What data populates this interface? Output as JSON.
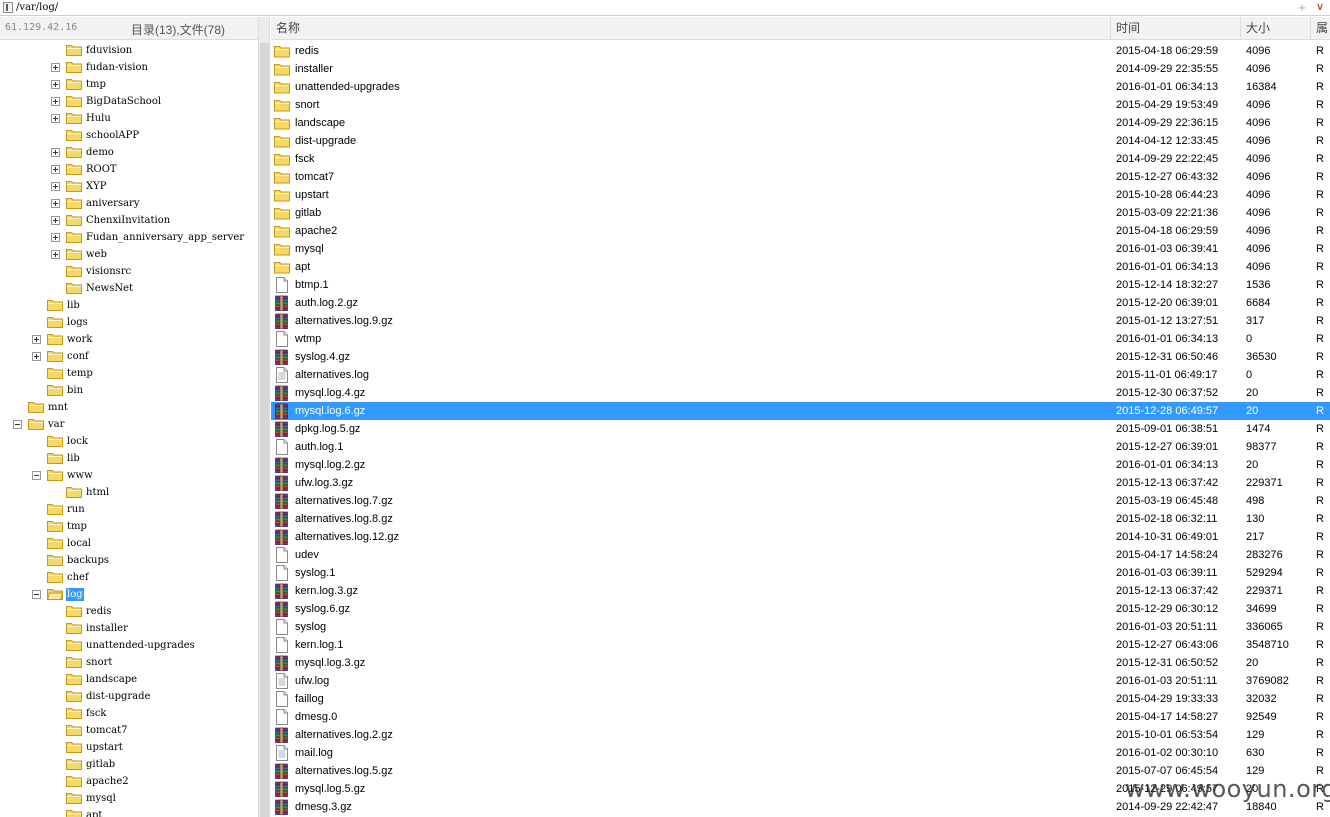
{
  "address_bar": {
    "path": "/var/log/"
  },
  "left_panel": {
    "host": "61.129.42.16",
    "summary": "目录(13),文件(78)",
    "tree": [
      {
        "label": "fduvision",
        "level": 3,
        "toggle": "none"
      },
      {
        "label": "fudan-vision",
        "level": 3,
        "toggle": "plus"
      },
      {
        "label": "tmp",
        "level": 3,
        "toggle": "plus"
      },
      {
        "label": "BigDataSchool",
        "level": 3,
        "toggle": "plus"
      },
      {
        "label": "Hulu",
        "level": 3,
        "toggle": "plus"
      },
      {
        "label": "schoolAPP",
        "level": 3,
        "toggle": "none"
      },
      {
        "label": "demo",
        "level": 3,
        "toggle": "plus"
      },
      {
        "label": "ROOT",
        "level": 3,
        "toggle": "plus"
      },
      {
        "label": "XYP",
        "level": 3,
        "toggle": "plus"
      },
      {
        "label": "aniversary",
        "level": 3,
        "toggle": "plus"
      },
      {
        "label": "ChenxiInvitation",
        "level": 3,
        "toggle": "plus"
      },
      {
        "label": "Fudan_anniversary_app_server",
        "level": 3,
        "toggle": "plus"
      },
      {
        "label": "web",
        "level": 3,
        "toggle": "plus"
      },
      {
        "label": "visionsrc",
        "level": 3,
        "toggle": "none"
      },
      {
        "label": "NewsNet",
        "level": 3,
        "toggle": "none"
      },
      {
        "label": "lib",
        "level": 2,
        "toggle": "none"
      },
      {
        "label": "logs",
        "level": 2,
        "toggle": "none"
      },
      {
        "label": "work",
        "level": 2,
        "toggle": "plus"
      },
      {
        "label": "conf",
        "level": 2,
        "toggle": "plus"
      },
      {
        "label": "temp",
        "level": 2,
        "toggle": "none"
      },
      {
        "label": "bin",
        "level": 2,
        "toggle": "none"
      },
      {
        "label": "mnt",
        "level": 1,
        "toggle": "none"
      },
      {
        "label": "var",
        "level": 1,
        "toggle": "minus"
      },
      {
        "label": "lock",
        "level": 2,
        "toggle": "none"
      },
      {
        "label": "lib",
        "level": 2,
        "toggle": "none"
      },
      {
        "label": "www",
        "level": 2,
        "toggle": "minus"
      },
      {
        "label": "html",
        "level": 3,
        "toggle": "none"
      },
      {
        "label": "run",
        "level": 2,
        "toggle": "none"
      },
      {
        "label": "tmp",
        "level": 2,
        "toggle": "none"
      },
      {
        "label": "local",
        "level": 2,
        "toggle": "none"
      },
      {
        "label": "backups",
        "level": 2,
        "toggle": "none"
      },
      {
        "label": "chef",
        "level": 2,
        "toggle": "none"
      },
      {
        "label": "log",
        "level": 2,
        "toggle": "minus",
        "selected": true,
        "open": true
      },
      {
        "label": "redis",
        "level": 3,
        "toggle": "none"
      },
      {
        "label": "installer",
        "level": 3,
        "toggle": "none"
      },
      {
        "label": "unattended-upgrades",
        "level": 3,
        "toggle": "none"
      },
      {
        "label": "snort",
        "level": 3,
        "toggle": "none"
      },
      {
        "label": "landscape",
        "level": 3,
        "toggle": "none"
      },
      {
        "label": "dist-upgrade",
        "level": 3,
        "toggle": "none"
      },
      {
        "label": "fsck",
        "level": 3,
        "toggle": "none"
      },
      {
        "label": "tomcat7",
        "level": 3,
        "toggle": "none"
      },
      {
        "label": "upstart",
        "level": 3,
        "toggle": "none"
      },
      {
        "label": "gitlab",
        "level": 3,
        "toggle": "none"
      },
      {
        "label": "apache2",
        "level": 3,
        "toggle": "none"
      },
      {
        "label": "mysql",
        "level": 3,
        "toggle": "none"
      },
      {
        "label": "apt",
        "level": 3,
        "toggle": "none"
      }
    ]
  },
  "file_list": {
    "columns": {
      "name": "名称",
      "time": "时间",
      "size": "大小",
      "perm": "属"
    },
    "files": [
      {
        "name": "redis",
        "time": "2015-04-18 06:29:59",
        "size": "4096",
        "perm": "R",
        "type": "folder"
      },
      {
        "name": "installer",
        "time": "2014-09-29 22:35:55",
        "size": "4096",
        "perm": "R",
        "type": "folder"
      },
      {
        "name": "unattended-upgrades",
        "time": "2016-01-01 06:34:13",
        "size": "16384",
        "perm": "R",
        "type": "folder"
      },
      {
        "name": "snort",
        "time": "2015-04-29 19:53:49",
        "size": "4096",
        "perm": "R",
        "type": "folder"
      },
      {
        "name": "landscape",
        "time": "2014-09-29 22:36:15",
        "size": "4096",
        "perm": "R",
        "type": "folder"
      },
      {
        "name": "dist-upgrade",
        "time": "2014-04-12 12:33:45",
        "size": "4096",
        "perm": "R",
        "type": "folder"
      },
      {
        "name": "fsck",
        "time": "2014-09-29 22:22:45",
        "size": "4096",
        "perm": "R",
        "type": "folder"
      },
      {
        "name": "tomcat7",
        "time": "2015-12-27 06:43:32",
        "size": "4096",
        "perm": "R",
        "type": "folder"
      },
      {
        "name": "upstart",
        "time": "2015-10-28 06:44:23",
        "size": "4096",
        "perm": "R",
        "type": "folder"
      },
      {
        "name": "gitlab",
        "time": "2015-03-09 22:21:36",
        "size": "4096",
        "perm": "R",
        "type": "folder"
      },
      {
        "name": "apache2",
        "time": "2015-04-18 06:29:59",
        "size": "4096",
        "perm": "R",
        "type": "folder"
      },
      {
        "name": "mysql",
        "time": "2016-01-03 06:39:41",
        "size": "4096",
        "perm": "R",
        "type": "folder"
      },
      {
        "name": "apt",
        "time": "2016-01-01 06:34:13",
        "size": "4096",
        "perm": "R",
        "type": "folder"
      },
      {
        "name": "btmp.1",
        "time": "2015-12-14 18:32:27",
        "size": "1536",
        "perm": "R",
        "type": "file"
      },
      {
        "name": "auth.log.2.gz",
        "time": "2015-12-20 06:39:01",
        "size": "6684",
        "perm": "R",
        "type": "archive"
      },
      {
        "name": "alternatives.log.9.gz",
        "time": "2015-01-12 13:27:51",
        "size": "317",
        "perm": "R",
        "type": "archive"
      },
      {
        "name": "wtmp",
        "time": "2016-01-01 06:34:13",
        "size": "0",
        "perm": "R",
        "type": "file"
      },
      {
        "name": "syslog.4.gz",
        "time": "2015-12-31 06:50:46",
        "size": "36530",
        "perm": "R",
        "type": "archive"
      },
      {
        "name": "alternatives.log",
        "time": "2015-11-01 06:49:17",
        "size": "0",
        "perm": "R",
        "type": "text"
      },
      {
        "name": "mysql.log.4.gz",
        "time": "2015-12-30 06:37:52",
        "size": "20",
        "perm": "R",
        "type": "archive"
      },
      {
        "name": "mysql.log.6.gz",
        "time": "2015-12-28 06:49:57",
        "size": "20",
        "perm": "R",
        "type": "archive",
        "selected": true
      },
      {
        "name": "dpkg.log.5.gz",
        "time": "2015-09-01 06:38:51",
        "size": "1474",
        "perm": "R",
        "type": "archive"
      },
      {
        "name": "auth.log.1",
        "time": "2015-12-27 06:39:01",
        "size": "98377",
        "perm": "R",
        "type": "file"
      },
      {
        "name": "mysql.log.2.gz",
        "time": "2016-01-01 06:34:13",
        "size": "20",
        "perm": "R",
        "type": "archive"
      },
      {
        "name": "ufw.log.3.gz",
        "time": "2015-12-13 06:37:42",
        "size": "229371",
        "perm": "R",
        "type": "archive"
      },
      {
        "name": "alternatives.log.7.gz",
        "time": "2015-03-19 06:45:48",
        "size": "498",
        "perm": "R",
        "type": "archive"
      },
      {
        "name": "alternatives.log.8.gz",
        "time": "2015-02-18 06:32:11",
        "size": "130",
        "perm": "R",
        "type": "archive"
      },
      {
        "name": "alternatives.log.12.gz",
        "time": "2014-10-31 06:49:01",
        "size": "217",
        "perm": "R",
        "type": "archive"
      },
      {
        "name": "udev",
        "time": "2015-04-17 14:58:24",
        "size": "283276",
        "perm": "R",
        "type": "file"
      },
      {
        "name": "syslog.1",
        "time": "2016-01-03 06:39:11",
        "size": "529294",
        "perm": "R",
        "type": "file"
      },
      {
        "name": "kern.log.3.gz",
        "time": "2015-12-13 06:37:42",
        "size": "229371",
        "perm": "R",
        "type": "archive"
      },
      {
        "name": "syslog.6.gz",
        "time": "2015-12-29 06:30:12",
        "size": "34699",
        "perm": "R",
        "type": "archive"
      },
      {
        "name": "syslog",
        "time": "2016-01-03 20:51:11",
        "size": "336065",
        "perm": "R",
        "type": "file"
      },
      {
        "name": "kern.log.1",
        "time": "2015-12-27 06:43:06",
        "size": "3548710",
        "perm": "R",
        "type": "file"
      },
      {
        "name": "mysql.log.3.gz",
        "time": "2015-12-31 06:50:52",
        "size": "20",
        "perm": "R",
        "type": "archive"
      },
      {
        "name": "ufw.log",
        "time": "2016-01-03 20:51:11",
        "size": "3769082",
        "perm": "R",
        "type": "text"
      },
      {
        "name": "faillog",
        "time": "2015-04-29 19:33:33",
        "size": "32032",
        "perm": "R",
        "type": "file"
      },
      {
        "name": "dmesg.0",
        "time": "2015-04-17 14:58:27",
        "size": "92549",
        "perm": "R",
        "type": "file"
      },
      {
        "name": "alternatives.log.2.gz",
        "time": "2015-10-01 06:53:54",
        "size": "129",
        "perm": "R",
        "type": "archive"
      },
      {
        "name": "mail.log",
        "time": "2016-01-02 00:30:10",
        "size": "630",
        "perm": "R",
        "type": "text"
      },
      {
        "name": "alternatives.log.5.gz",
        "time": "2015-07-07 06:45:54",
        "size": "129",
        "perm": "R",
        "type": "archive"
      },
      {
        "name": "mysql.log.5.gz",
        "time": "2015-12-29 06:49:57",
        "size": "20",
        "perm": "R",
        "type": "archive"
      },
      {
        "name": "dmesg.3.gz",
        "time": "2014-09-29 22:42:47",
        "size": "18840",
        "perm": "R",
        "type": "archive"
      }
    ]
  },
  "watermark": "www.wooyun.org",
  "colors": {
    "selection": "#3399ff",
    "folder": "#f5d86a",
    "folder_border": "#c49a1a",
    "toggle_accent": "#cc2200"
  }
}
